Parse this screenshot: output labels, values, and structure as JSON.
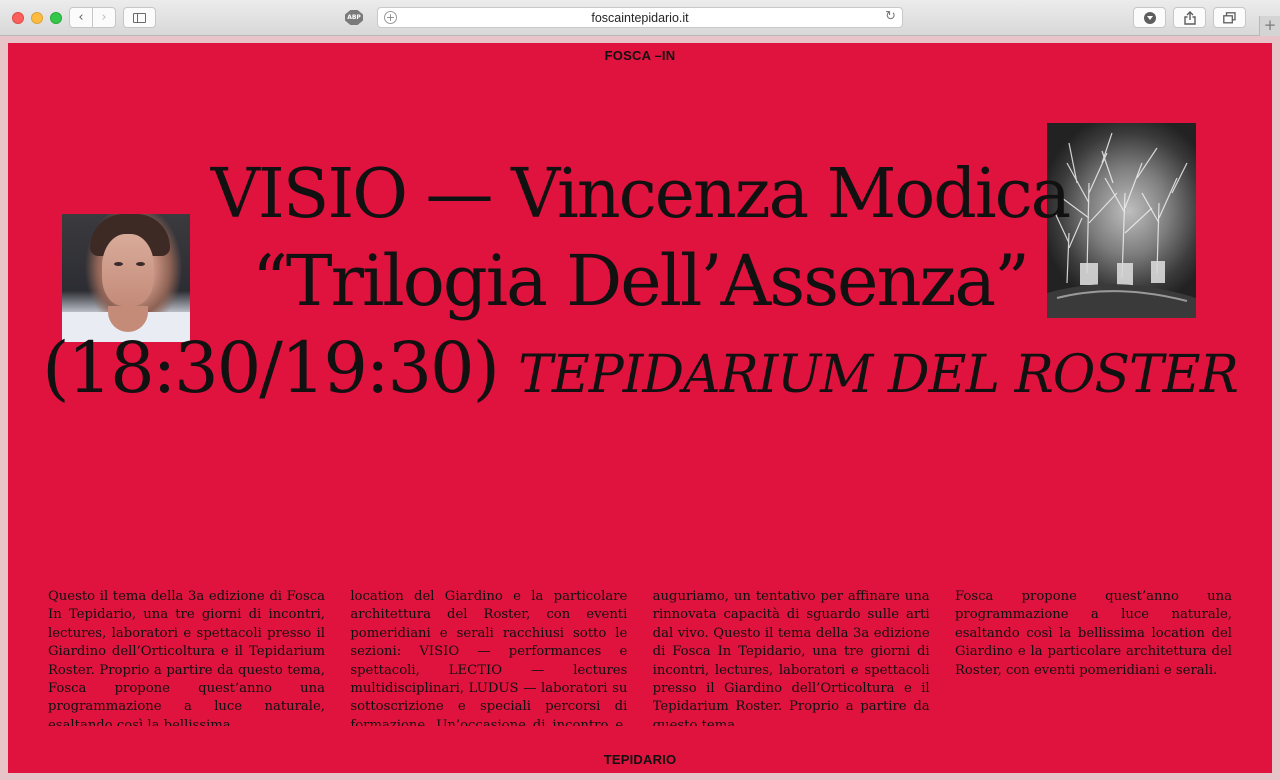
{
  "browser": {
    "url": "foscaintepidario.it",
    "adblock_label": "ABP",
    "back_icon": "‹",
    "forward_icon": "›",
    "reload_icon": "↻",
    "new_tab_icon": "+"
  },
  "site": {
    "logo_top": "FOSCA –IN",
    "logo_bottom": "TEPIDARIO"
  },
  "headline": {
    "line1": "VISIO — Vincenza Modica",
    "line2": "“Trilogia Dell’Assenza”",
    "time": "(18:30/19:30)",
    "venue": "TEPIDARIUM DEL ROSTER"
  },
  "body_columns": [
    "Questo il tema della 3a edizione di Fosca In Tepidario, una tre giorni di incontri, lectures, laboratori e spettacoli presso il Giardino dell’Orticoltura e il Tepidarium Roster. Proprio a partire da questo tema, Fosca propone quest’anno una programmazione a luce naturale, esaltando così la bellissima",
    "location del Giardino e la particolare architettura del Roster, con eventi pomeridiani e serali racchiusi sotto le sezioni: VISIO — performances e spettacoli, LECTIO — lectures multidisciplinari, LUDUS — laboratori su sottoscrizione e speciali percorsi di formazione. Un’occasione di incontro e, ci",
    "auguriamo, un tentativo per affinare una rinnovata capacità di sguardo sulle arti dal vivo. Questo il tema della 3a edizione di Fosca In Tepidario, una tre giorni di incontri, lectures, laboratori e spettacoli presso il Giardino dell’Orticoltura e il Tepidarium Roster. Proprio a partire da questo tema,",
    "Fosca propone quest’anno una programmazione a luce naturale, esaltando così la bellissima location del Giardino e la particolare architettura del Roster, con eventi pomeridiani e serali."
  ],
  "colors": {
    "page_background": "#e0123e",
    "text": "#111111"
  }
}
